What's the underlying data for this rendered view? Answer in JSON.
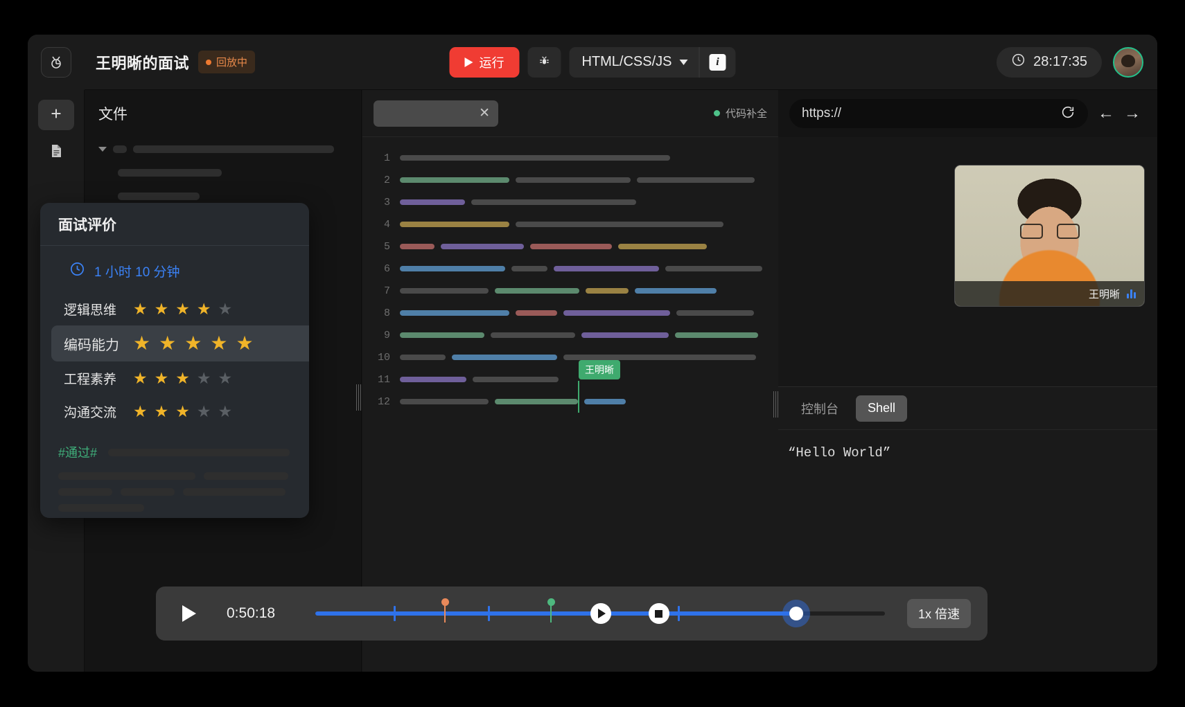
{
  "header": {
    "logo_icon": "bug-logo-icon",
    "project_title": "王明晰的面试",
    "replay_badge": "回放中",
    "run_label": "运行",
    "debug_icon": "bug-icon",
    "language": "HTML/CSS/JS",
    "info_label": "i",
    "timer": "28:17:35",
    "clock_icon": "clock-icon",
    "avatar": "avatar"
  },
  "rail": {
    "add_icon": "plus-icon",
    "file_icon": "document-icon"
  },
  "files": {
    "title": "文件"
  },
  "editor": {
    "tab_close_icon": "close-icon",
    "completion_label": "代码补全",
    "line_numbers": [
      "1",
      "2",
      "3",
      "4",
      "5",
      "6",
      "7",
      "8",
      "9",
      "10",
      "11",
      "12"
    ],
    "cursor_user": "王明晰"
  },
  "preview": {
    "url": "https://",
    "refresh_icon": "refresh-icon",
    "back_icon": "arrow-left-icon",
    "forward_icon": "arrow-right-icon",
    "video_name": "王明晰",
    "audio_icon": "audio-level-icon"
  },
  "console": {
    "tabs": [
      {
        "label": "控制台",
        "active": false
      },
      {
        "label": "Shell",
        "active": true
      }
    ],
    "output": "“Hello World”"
  },
  "evaluation": {
    "title": "面试评价",
    "duration_icon": "clock-icon",
    "duration": "1 小时 10 分钟",
    "ratings": [
      {
        "label": "逻辑思维",
        "score": 4,
        "max": 5,
        "highlighted": false
      },
      {
        "label": "编码能力",
        "score": 5,
        "max": 5,
        "highlighted": true
      },
      {
        "label": "工程素养",
        "score": 3,
        "max": 5,
        "highlighted": false
      },
      {
        "label": "沟通交流",
        "score": 3,
        "max": 5,
        "highlighted": false
      }
    ],
    "pass_tag": "#通过#"
  },
  "playback": {
    "play_icon": "play-icon",
    "current_time": "0:50:18",
    "speed_label": "1x 倍速",
    "progress_percent": 84,
    "markers": [
      {
        "type": "tick",
        "pos": 13.8
      },
      {
        "type": "tick",
        "pos": 30.3
      },
      {
        "type": "pin",
        "pos": 22.6,
        "color": "#e8895a"
      },
      {
        "type": "pin",
        "pos": 41.2,
        "color": "#4eb87e"
      },
      {
        "type": "play",
        "pos": 49.0
      },
      {
        "type": "stop",
        "pos": 59.2
      },
      {
        "type": "tick",
        "pos": 63.6
      }
    ]
  },
  "colors": {
    "accent_red": "#f03c33",
    "accent_blue": "#2f72ea",
    "accent_green": "#3faa6e",
    "star_gold": "#f0b429",
    "badge_orange": "#ef7a30"
  }
}
